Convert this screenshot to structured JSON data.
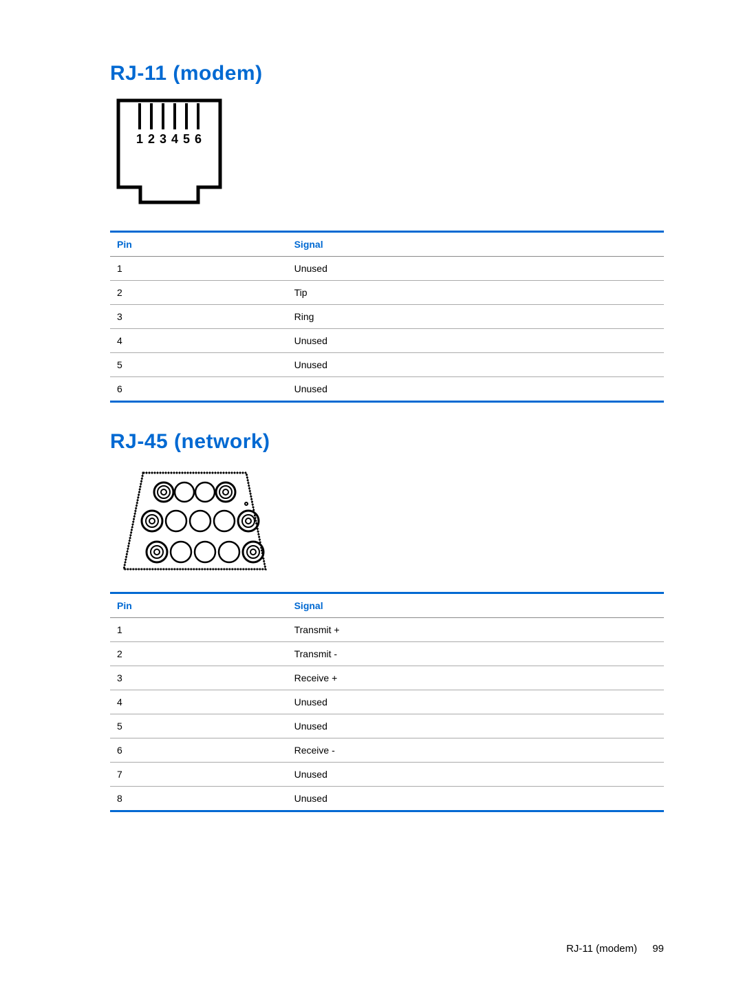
{
  "sections": [
    {
      "title": "RJ-11 (modem)",
      "diagram": "rj11",
      "columns": {
        "pin": "Pin",
        "signal": "Signal"
      },
      "rows": [
        {
          "pin": "1",
          "signal": "Unused"
        },
        {
          "pin": "2",
          "signal": "Tip"
        },
        {
          "pin": "3",
          "signal": "Ring"
        },
        {
          "pin": "4",
          "signal": "Unused"
        },
        {
          "pin": "5",
          "signal": "Unused"
        },
        {
          "pin": "6",
          "signal": "Unused"
        }
      ]
    },
    {
      "title": "RJ-45 (network)",
      "diagram": "rj45",
      "columns": {
        "pin": "Pin",
        "signal": "Signal"
      },
      "rows": [
        {
          "pin": "1",
          "signal": "Transmit +"
        },
        {
          "pin": "2",
          "signal": "Transmit -"
        },
        {
          "pin": "3",
          "signal": "Receive +"
        },
        {
          "pin": "4",
          "signal": "Unused"
        },
        {
          "pin": "5",
          "signal": "Unused"
        },
        {
          "pin": "6",
          "signal": "Receive -"
        },
        {
          "pin": "7",
          "signal": "Unused"
        },
        {
          "pin": "8",
          "signal": "Unused"
        }
      ]
    }
  ],
  "rj11_pin_labels": [
    "1",
    "2",
    "3",
    "4",
    "5",
    "6"
  ],
  "footer": {
    "label": "RJ-11 (modem)",
    "page": "99"
  }
}
